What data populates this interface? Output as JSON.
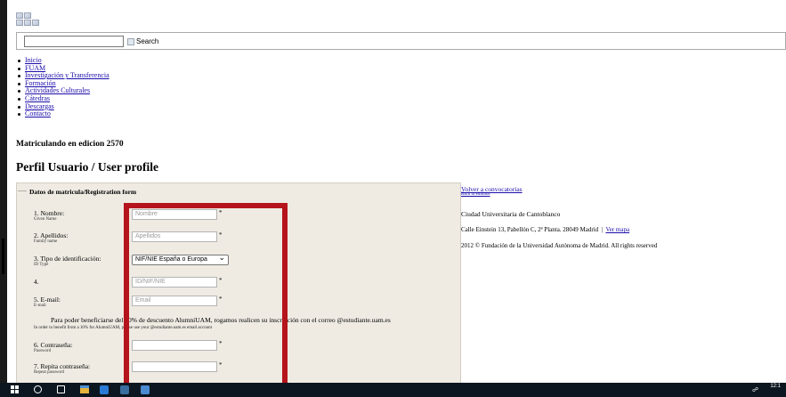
{
  "search": {
    "placeholder": "",
    "button_label": "Search"
  },
  "nav": [
    {
      "label": "Inicio"
    },
    {
      "label": "FUAM"
    },
    {
      "label": "Investigación y Transferencia"
    },
    {
      "label": "Formación"
    },
    {
      "label": "Actividades Culturales"
    },
    {
      "label": "Cátedras"
    },
    {
      "label": "Descargas"
    },
    {
      "label": "Contacto"
    }
  ],
  "enrolling": "Matriculando en edicion 2570",
  "page_title": "Perfil Usuario / User profile",
  "form": {
    "legend": "Datos de matricula/Registration form",
    "fields": [
      {
        "label": "1. Nombre:",
        "sub": "Given Name",
        "placeholder": "Nombre",
        "required": "*"
      },
      {
        "label": "2. Apellidos:",
        "sub": "Family name",
        "placeholder": "Apellidos",
        "required": "*"
      },
      {
        "label": "3. Tipo de identificación:",
        "sub": "ID Type",
        "selected": "NIF/NIE España o Europa"
      },
      {
        "label": "4.",
        "sub": "",
        "placeholder": "ID/NIF/NIE",
        "required": "*"
      },
      {
        "label": "5. E-mail:",
        "sub": "E-mail",
        "placeholder": "Email",
        "required": "*"
      },
      {
        "label": "6. Contraseña:",
        "sub": "Password",
        "placeholder": "",
        "required": "*"
      },
      {
        "label": "7. Repita contraseña:",
        "sub": "Repeat password",
        "placeholder": "",
        "required": "*"
      }
    ],
    "note": "Para poder beneficiarse del 10% de descuento AlumniUAM, rogamos realicen su inscripción con el correo @estudiante.uam.es",
    "note_en": "In order to benefit from a 10% for AlumniUAM, please use your @estudiante.uam.es email account"
  },
  "side": {
    "back_link": "Volver a convocatorias",
    "back_link_en": "Back to editions",
    "campus": "Ciudad Universitaria de Cantoblanco",
    "address": "Calle Einstein 13, Pabellón C, 2ª Planta. 28049 Madrid",
    "separator": "|",
    "map_link": "Ver mapa",
    "copyright": "2012 © Fundación de la Universidad Autónoma de Madrid. All rights reserved"
  },
  "taskbar": {
    "time": "12:1",
    "date": ""
  },
  "colors": {
    "highlight": "#b5141c",
    "link": "#1a0dab",
    "form_bg": "#efebe3",
    "taskbar": "#0c1620"
  },
  "icons": [
    "windows-start-icon",
    "search-icon",
    "task-view-icon",
    "file-explorer-icon",
    "browser-icon",
    "network-icon"
  ]
}
